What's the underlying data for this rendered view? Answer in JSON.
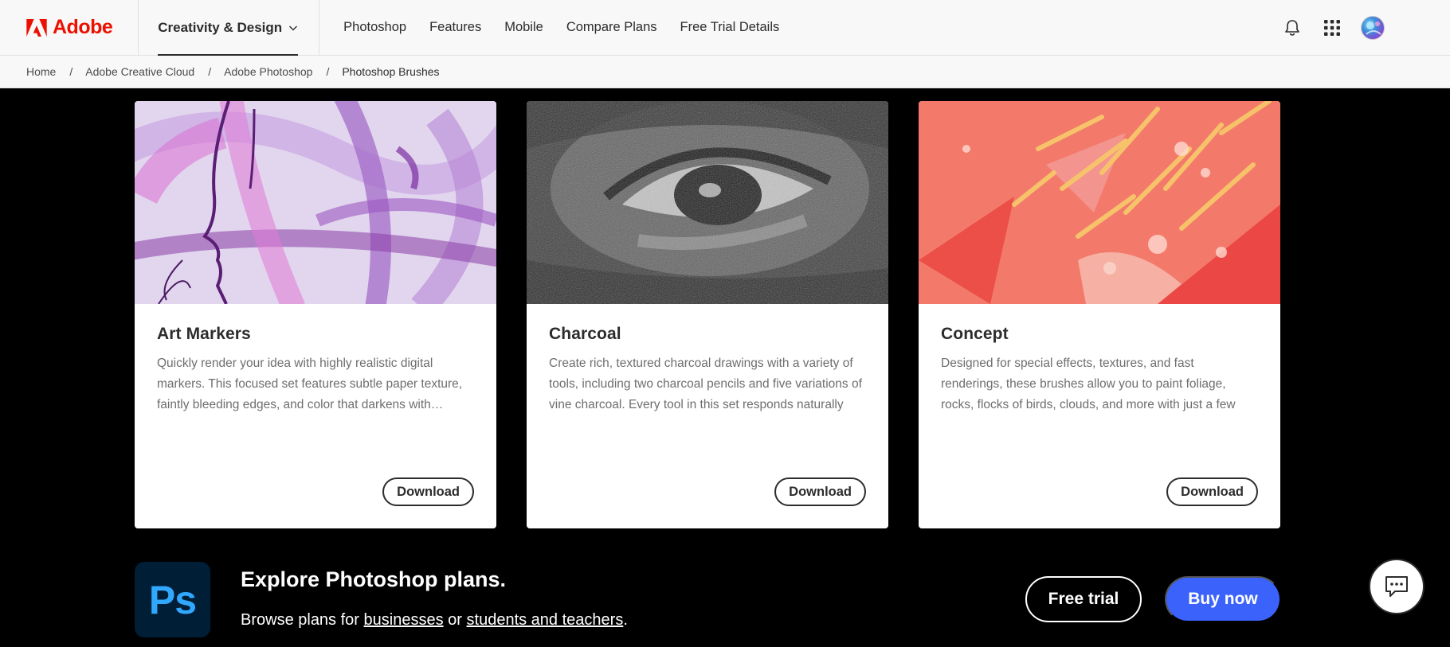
{
  "brand": {
    "name": "Adobe",
    "color": "#eb1000"
  },
  "nav": {
    "primary": {
      "label": "Creativity & Design"
    },
    "links": [
      "Photoshop",
      "Features",
      "Mobile",
      "Compare Plans",
      "Free Trial Details"
    ],
    "icons": [
      "bell-icon",
      "app-grid-icon",
      "avatar"
    ]
  },
  "breadcrumb": {
    "items": [
      "Home",
      "Adobe Creative Cloud",
      "Adobe Photoshop",
      "Photoshop Brushes"
    ],
    "separator": "/"
  },
  "cards": [
    {
      "title": "Art Markers",
      "description": "Quickly render your idea with highly realistic digital markers. This focused set features subtle paper texture, faintly bleeding edges, and color that darkens with…",
      "button": "Download"
    },
    {
      "title": "Charcoal",
      "description": "Create rich, textured charcoal drawings with a variety of tools, including two charcoal pencils and five variations of vine charcoal. Every tool in this set responds naturally to…",
      "button": "Download"
    },
    {
      "title": "Concept",
      "description": "Designed for special effects, textures, and fast renderings, these brushes allow you to paint foliage, rocks, flocks of birds, clouds, and more with just a few strokes of your…",
      "button": "Download"
    }
  ],
  "promo": {
    "app_icon_text": "Ps",
    "title": "Explore Photoshop plans.",
    "subtitle_prefix": "Browse plans for",
    "link_businesses": "businesses",
    "subtitle_or": "or",
    "link_students": "students and teachers",
    "subtitle_suffix": ".",
    "free_trial": "Free trial",
    "buy_now": "Buy now",
    "buy_color": "#3b63fb"
  }
}
